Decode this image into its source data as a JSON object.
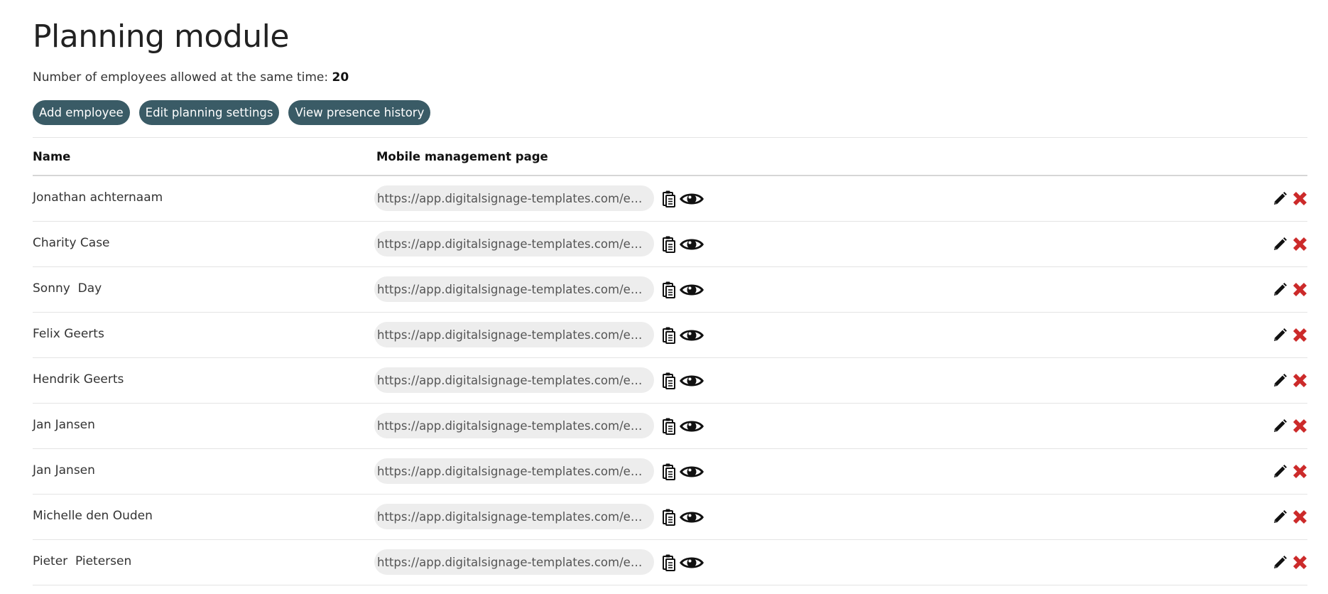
{
  "page": {
    "title": "Planning module",
    "allowed_label": "Number of employees allowed at the same time:",
    "allowed_value": "20"
  },
  "actions": {
    "add_employee": "Add employee",
    "edit_settings": "Edit planning settings",
    "view_history": "View presence history"
  },
  "table": {
    "headers": {
      "name": "Name",
      "mobile": "Mobile management page"
    },
    "rows": [
      {
        "name": "Jonathan achternaam",
        "url": "https://app.digitalsignage-templates.com/employee"
      },
      {
        "name": "Charity Case",
        "url": "https://app.digitalsignage-templates.com/employee"
      },
      {
        "name": "Sonny  Day",
        "url": "https://app.digitalsignage-templates.com/employee"
      },
      {
        "name": "Felix Geerts",
        "url": "https://app.digitalsignage-templates.com/employee"
      },
      {
        "name": "Hendrik Geerts",
        "url": "https://app.digitalsignage-templates.com/employee"
      },
      {
        "name": "Jan Jansen",
        "url": "https://app.digitalsignage-templates.com/employee"
      },
      {
        "name": "Jan Jansen",
        "url": "https://app.digitalsignage-templates.com/employee"
      },
      {
        "name": "Michelle den Ouden",
        "url": "https://app.digitalsignage-templates.com/employee"
      },
      {
        "name": "Pieter  Pietersen",
        "url": "https://app.digitalsignage-templates.com/employee"
      }
    ]
  },
  "icons": {
    "copy": "clipboard-icon",
    "view": "eye-icon",
    "edit": "pencil-icon",
    "delete": "close-icon"
  },
  "colors": {
    "button_bg": "#3a5b66",
    "delete": "#cc2a2a",
    "url_field_bg": "#ededed"
  }
}
